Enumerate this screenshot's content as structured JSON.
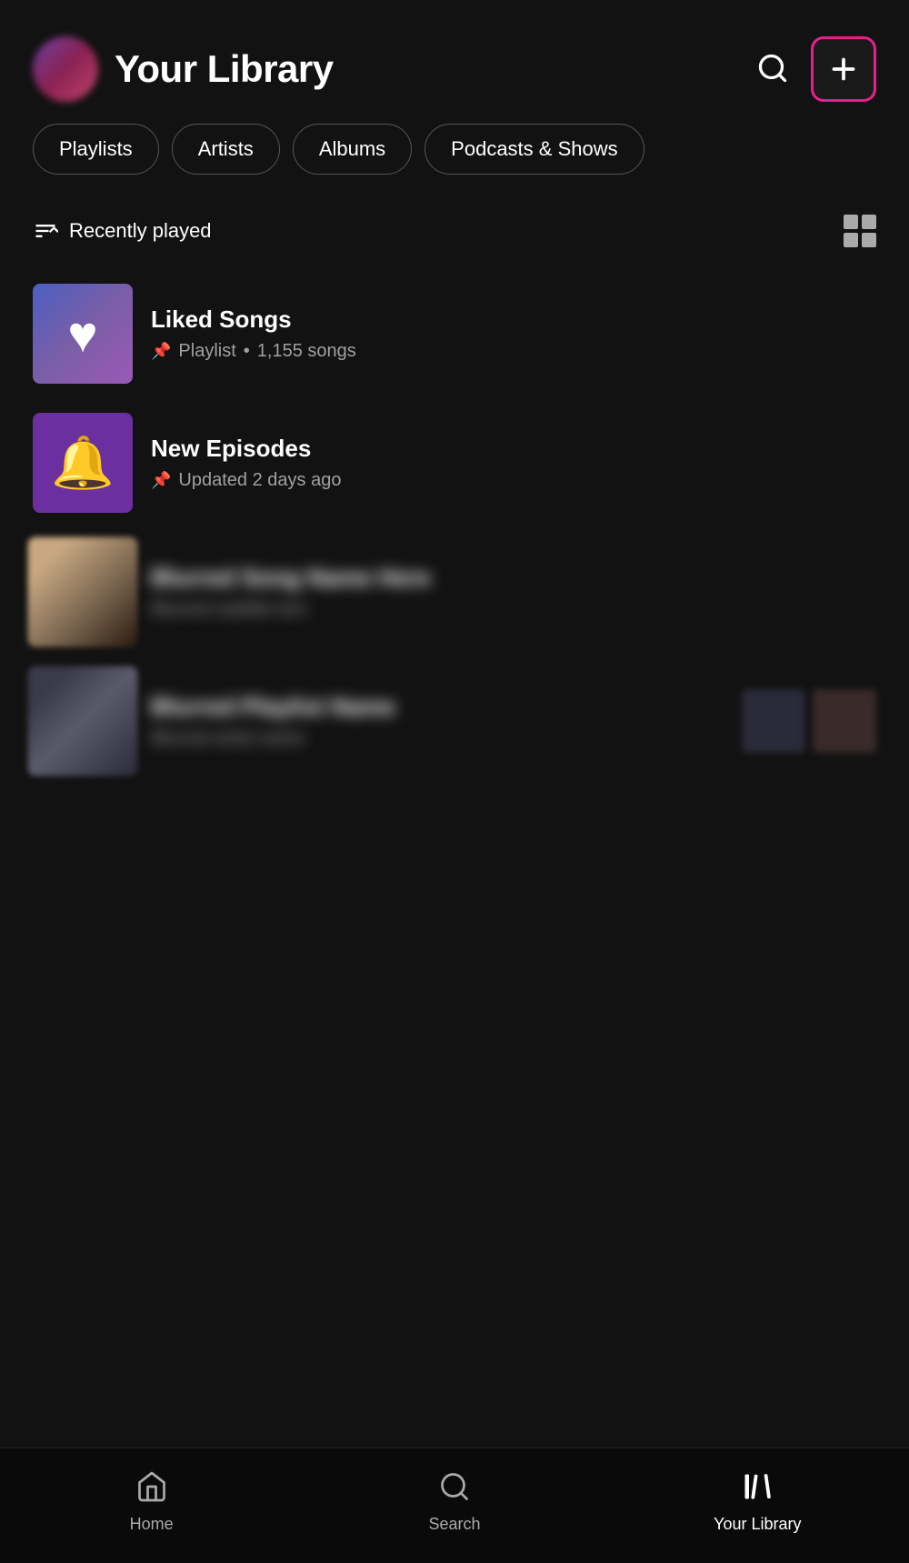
{
  "header": {
    "title": "Your Library",
    "search_label": "Search",
    "add_label": "Add"
  },
  "filters": [
    {
      "label": "Playlists",
      "active": false
    },
    {
      "label": "Artists",
      "active": false
    },
    {
      "label": "Albums",
      "active": false
    },
    {
      "label": "Podcasts & Shows",
      "active": false
    }
  ],
  "sort": {
    "label": "Recently played"
  },
  "items": [
    {
      "id": "liked-songs",
      "name": "Liked Songs",
      "type": "Playlist",
      "meta": "1,155 songs",
      "pinned": true,
      "art_type": "liked"
    },
    {
      "id": "new-episodes",
      "name": "New Episodes",
      "type": "",
      "meta": "Updated 2 days ago",
      "pinned": true,
      "art_type": "episodes"
    },
    {
      "id": "item3",
      "name": "Blurred Content",
      "type": "",
      "meta": "Blurred subtitle",
      "pinned": false,
      "art_type": "blurred3"
    },
    {
      "id": "item4",
      "name": "Blurred Content 2",
      "type": "",
      "meta": "Blurred subtitle 2",
      "pinned": false,
      "art_type": "blurred4"
    }
  ],
  "bottom_nav": {
    "items": [
      {
        "id": "home",
        "label": "Home",
        "active": false
      },
      {
        "id": "search",
        "label": "Search",
        "active": false
      },
      {
        "id": "library",
        "label": "Your Library",
        "active": true
      }
    ]
  }
}
